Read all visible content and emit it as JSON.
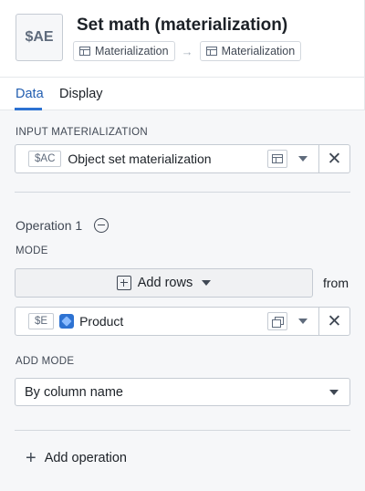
{
  "node": {
    "badge": "$AE",
    "title": "Set math (materialization)",
    "breadcrumb": {
      "from": "Materialization",
      "to": "Materialization"
    }
  },
  "tabs": [
    {
      "label": "Data",
      "active": true
    },
    {
      "label": "Display",
      "active": false
    }
  ],
  "input_materialization": {
    "label": "INPUT MATERIALIZATION",
    "tag": "$AC",
    "value": "Object set materialization"
  },
  "operation": {
    "title": "Operation 1",
    "mode_label": "MODE",
    "mode_value": "Add rows",
    "from_label": "from",
    "source_tag": "$E",
    "source_value": "Product",
    "add_mode_label": "ADD MODE",
    "add_mode_value": "By column name"
  },
  "add_operation_label": "Add operation",
  "icons": {
    "table": "table-icon",
    "arrow": "arrow-right-icon",
    "caret": "caret-down-icon",
    "close": "close-icon",
    "remove": "minus-circle-icon",
    "add_rows": "plus-square-icon",
    "object": "cube-icon",
    "object_set": "object-set-icon",
    "add": "plus-icon"
  },
  "colors": {
    "accent": "#2d72d2",
    "active_tab": "#215db0"
  }
}
